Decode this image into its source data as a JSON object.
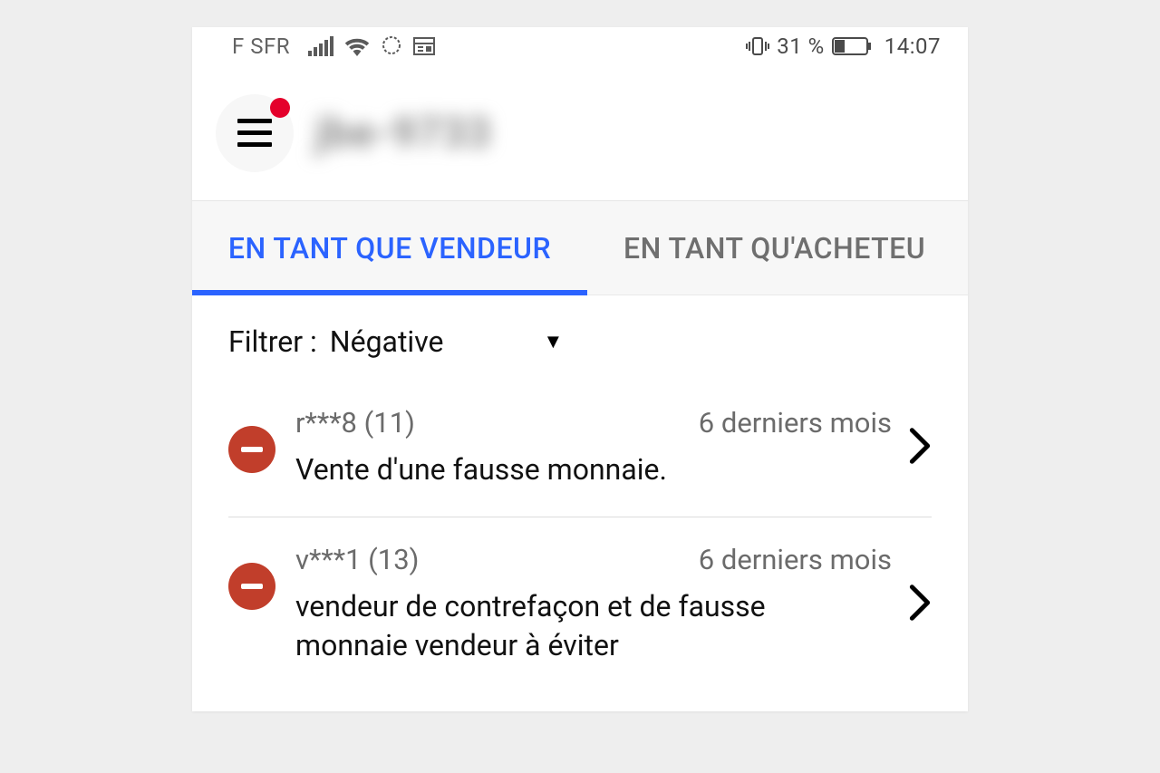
{
  "status": {
    "carrier": "F SFR",
    "battery_text": "31 %",
    "clock": "14:07"
  },
  "header": {
    "username_blurred": "jbe-9733"
  },
  "tabs": {
    "seller": "EN TANT QUE VENDEUR",
    "buyer": "EN TANT QU'ACHETEU"
  },
  "filter": {
    "label": "Filtrer :",
    "value": "Négative"
  },
  "feedback": [
    {
      "user": "r***8 (11)",
      "timeframe": "6 derniers mois",
      "comment": "Vente d'une fausse monnaie."
    },
    {
      "user": "v***1 (13)",
      "timeframe": "6 derniers mois",
      "comment": "vendeur de contrefaçon et de fausse monnaie vendeur à éviter"
    }
  ]
}
